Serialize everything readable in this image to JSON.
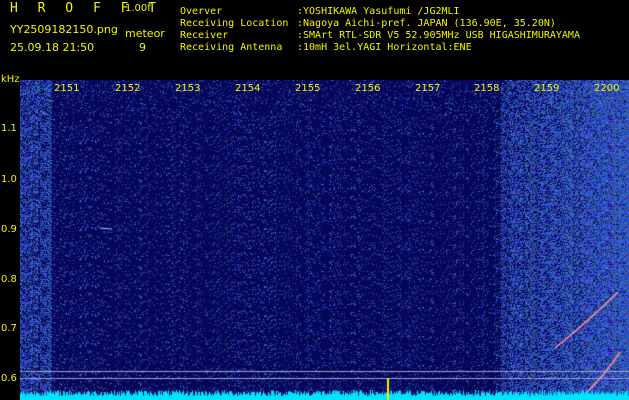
{
  "header": {
    "app_name": "H R O F F T",
    "version": "1.00f",
    "filename": "YY2509182150.png",
    "meteor_label": "meteor",
    "datetime": "25.09.18 21:50",
    "meteor_count": "9"
  },
  "info": [
    {
      "key": "Overver",
      "value": ":YOSHIKAWA Yasufumi /JG2MLI"
    },
    {
      "key": "Receiving Location",
      "value": ":Nagoya Aichi-pref. JAPAN (136.90E, 35.20N)"
    },
    {
      "key": "Receiver",
      "value": ":SMArt RTL-SDR V5 52.905MHz USB HIGASHIMURAYAMA"
    },
    {
      "key": "Receiving Antenna",
      "value": ":10mH 3el.YAGI Horizontal:ENE"
    }
  ],
  "axis": {
    "y_unit": "kHz",
    "y_ticks": [
      "1.1",
      "1.0",
      "0.9",
      "0.8",
      "0.7",
      "0.6"
    ],
    "x_ticks": [
      "2151",
      "2152",
      "2153",
      "2154",
      "2155",
      "2156",
      "2157",
      "2158",
      "2159",
      "2200"
    ]
  },
  "colors": {
    "text": "#f5f500",
    "background": "#000000",
    "spectrum_bg": "#07075a",
    "noise": "#3a5cff",
    "meteor_trace": "#ff9090",
    "baseline": "#00e5ff"
  }
}
